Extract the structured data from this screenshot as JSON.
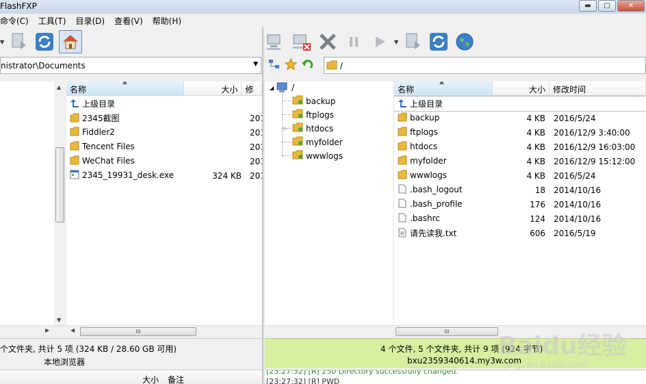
{
  "app": {
    "title": "FlashFXP"
  },
  "window_buttons": {
    "minimize": "▬",
    "maximize": "▢",
    "close": "✕"
  },
  "menu": [
    "命令(C)",
    "工具(T)",
    "目录(D)",
    "查看(V)",
    "帮助(H)"
  ],
  "left": {
    "path": "nistrator\\Documents",
    "columns": {
      "name": "名称",
      "size": "大小",
      "modified": "修"
    },
    "rows": [
      {
        "icon": "up-folder-icon",
        "name": "上级目录",
        "size": "",
        "date": ""
      },
      {
        "icon": "folder-icon",
        "name": "2345截图",
        "size": "",
        "date": "201"
      },
      {
        "icon": "folder-icon",
        "name": "Fiddler2",
        "size": "",
        "date": "201"
      },
      {
        "icon": "folder-icon",
        "name": "Tencent Files",
        "size": "",
        "date": "201"
      },
      {
        "icon": "folder-icon",
        "name": "WeChat Files",
        "size": "",
        "date": "201"
      },
      {
        "icon": "exe-icon",
        "name": "2345_19931_desk.exe",
        "size": "324 KB",
        "date": "201"
      }
    ],
    "status": "个文件夹, 共计 5 项 (324 KB / 28.60 GB 可用)",
    "label": "本地浏览器"
  },
  "right": {
    "path": "/",
    "tree": {
      "root": "/",
      "children": [
        "backup",
        "ftplogs",
        "htdocs",
        "myfolder",
        "wwwlogs"
      ]
    },
    "columns": {
      "name": "名称",
      "size": "大小",
      "modified": "修改时间"
    },
    "rows": [
      {
        "icon": "up-folder-icon",
        "name": "上级目录",
        "size": "",
        "date": ""
      },
      {
        "icon": "folder-icon",
        "name": "backup",
        "size": "4 KB",
        "date": "2016/5/24"
      },
      {
        "icon": "folder-icon",
        "name": "ftplogs",
        "size": "4 KB",
        "date": "2016/12/9 3:40:00"
      },
      {
        "icon": "folder-icon",
        "name": "htdocs",
        "size": "4 KB",
        "date": "2016/12/9 16:03:00"
      },
      {
        "icon": "folder-icon",
        "name": "myfolder",
        "size": "4 KB",
        "date": "2016/12/9 15:12:00"
      },
      {
        "icon": "folder-icon",
        "name": "wwwlogs",
        "size": "4 KB",
        "date": "2016/5/24"
      },
      {
        "icon": "file-icon",
        "name": ".bash_logout",
        "size": "18",
        "date": "2014/10/16"
      },
      {
        "icon": "file-icon",
        "name": ".bash_profile",
        "size": "176",
        "date": "2014/10/16"
      },
      {
        "icon": "file-icon",
        "name": ".bashrc",
        "size": "124",
        "date": "2014/10/16"
      },
      {
        "icon": "txt-icon",
        "name": "请先读我.txt",
        "size": "606",
        "date": "2016/5/19"
      }
    ],
    "status": "4 个文件, 5 个文件夹, 共计 9 项 (924 字节)",
    "server": "bxu2359340614.my3w.com"
  },
  "queue": {
    "size": "大小",
    "note": "备注"
  },
  "log": [
    "[23:27:52] [R] 250 Directory successfully changed.",
    "[23:27:32] [R] PWD"
  ],
  "watermark": {
    "brand": "Baidu经验",
    "sub": "jingyan.baidu.com"
  },
  "colors": {
    "connected_status": "#d7efa0",
    "folder": "#e8b93a",
    "selection": "#cde6f6"
  }
}
